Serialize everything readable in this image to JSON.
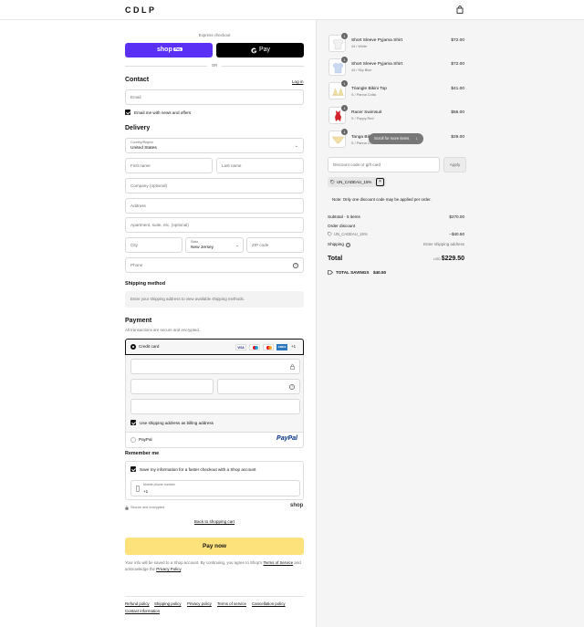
{
  "header": {
    "brand": "CDLP"
  },
  "express": {
    "title": "Express checkout",
    "shop_label": "shop",
    "shop_pay_label": "Pay",
    "gpay_label": "Pay",
    "or": "OR"
  },
  "contact": {
    "title": "Contact",
    "login": "Log in",
    "email_placeholder": "Email",
    "newsletter": "Email me with news and offers"
  },
  "delivery": {
    "title": "Delivery",
    "country_label": "Country/Region",
    "country": "United States",
    "first_name": "First name",
    "last_name": "Last name",
    "company": "Company (optional)",
    "address": "Address",
    "apartment": "Apartment, suite, etc. (optional)",
    "city": "City",
    "state_label": "State",
    "state": "New Jersey",
    "zip": "ZIP code",
    "phone": "Phone"
  },
  "shipping_method": {
    "title": "Shipping method",
    "note": "Enter your shipping address to view available shipping methods."
  },
  "payment": {
    "title": "Payment",
    "subtitle": "All transactions are secure and encrypted.",
    "credit_card": "Credit card",
    "more_cards": "+1",
    "card_brands": [
      "VISA",
      "",
      "",
      "AMEX"
    ],
    "billing_same": "Use shipping address as billing address",
    "paypal": "PayPal",
    "paypal_logo": "PayPal"
  },
  "remember": {
    "title": "Remember me",
    "save_info": "Save my information for a faster checkout with a Shop account",
    "mobile_label": "Mobile phone number",
    "mobile_prefix": "+1",
    "secure": "Secure and encrypted",
    "shop_logo": "shop"
  },
  "back_link": "Back to shopping cart",
  "pay_button": "Pay now",
  "legal": {
    "text": "Your info will be saved to a Shop account. By continuing, you agree to Shop's ",
    "terms": "Terms of Service",
    "and": " and acknowledge the ",
    "privacy": "Privacy Policy",
    "end": "."
  },
  "footer_links": [
    "Refund policy",
    "Shipping policy",
    "Privacy policy",
    "Terms of service",
    "Cancellation policy",
    "Contact information"
  ],
  "cart": {
    "items": [
      {
        "qty": "1",
        "name": "Short Sleeve Pyjama Shirt",
        "variant": "44 / White",
        "price": "$72.00"
      },
      {
        "qty": "1",
        "name": "Short Sleeve Pyjama Shirt",
        "variant": "44 / Sky Blue",
        "price": "$72.00"
      },
      {
        "qty": "1",
        "name": "Triangle Bikini Top",
        "variant": "S / Panna Cotta",
        "price": "$41.00"
      },
      {
        "qty": "1",
        "name": "Racer Swimsuit",
        "variant": "S / Poppy Red",
        "price": "$56.00"
      },
      {
        "qty": "1",
        "name": "Tanga Bikini",
        "variant": "S / Panna Cotta",
        "price": "$29.00"
      }
    ],
    "scroll_hint": "Scroll for more items",
    "discount_placeholder": "Discount code or gift card",
    "apply": "Apply",
    "code": "UN_CADEAU_15%",
    "note": "Note: Only one discount code may be applied per order.",
    "subtotal_label": "Subtotal · 5 items",
    "subtotal": "$270.00",
    "order_discount": "Order discount",
    "discount_code": "UN_CADEAU_15%",
    "discount_amount": "−$40.50",
    "shipping_label": "Shipping",
    "shipping_value": "Enter shipping address",
    "total_label": "Total",
    "currency": "USD",
    "total": "$229.50",
    "savings_label": "TOTAL SAVINGS",
    "savings": "$40.50"
  },
  "colors": {
    "shop_purple": "#5a31f4",
    "pay_yellow": "#fde27c",
    "right_bg": "#f5f5f5",
    "amex_blue": "#2e77bc"
  }
}
